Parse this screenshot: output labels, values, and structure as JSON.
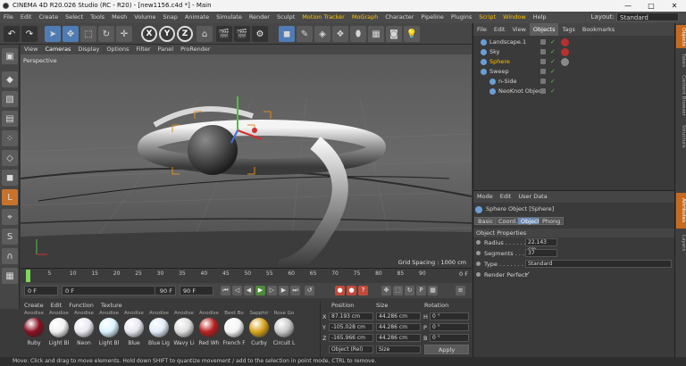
{
  "window": {
    "title": "CINEMA 4D R20.026 Studio (RC - R20) - [new1156.c4d *] - Main",
    "min": "—",
    "max": "□",
    "close": "✕"
  },
  "menubar": {
    "items": [
      "File",
      "Edit",
      "Create",
      "Select",
      "Tools",
      "Mesh",
      "Volume",
      "Snap",
      "Animate",
      "Simulate",
      "Render",
      "Sculpt",
      "Motion Tracker",
      "MoGraph",
      "Character",
      "Pipeline",
      "Plugins",
      "Script",
      "Window",
      "Help"
    ],
    "layout_label": "Layout:",
    "layout_value": "Standard"
  },
  "toolbar": {
    "x": "X",
    "y": "Y",
    "z": "Z"
  },
  "viewport": {
    "menu": [
      "View",
      "Cameras",
      "Display",
      "Options",
      "Filter",
      "Panel",
      "ProRender"
    ],
    "camera": "Perspective",
    "grid_spacing": "Grid Spacing : 1000 cm"
  },
  "timeline": {
    "ticks": [
      "0",
      "5",
      "10",
      "15",
      "20",
      "25",
      "30",
      "35",
      "40",
      "45",
      "50",
      "55",
      "60",
      "65",
      "70",
      "75",
      "80",
      "85",
      "90"
    ],
    "end": "0 F",
    "start_field": "0 F",
    "min_field": "0 F",
    "max_field": "90 F",
    "end_field": "90 F"
  },
  "materials": {
    "menu": [
      "Create",
      "Edit",
      "Function",
      "Texture"
    ],
    "items": [
      {
        "header": "Anodise",
        "name": "Ruby",
        "color": "#8a1020"
      },
      {
        "header": "Anodise",
        "name": "Light Bl",
        "color": "#f0f0f0"
      },
      {
        "header": "Anodise",
        "name": "Neon",
        "color": "#e8e8f0"
      },
      {
        "header": "Anodise",
        "name": "Light Bl",
        "color": "#d8f4ff"
      },
      {
        "header": "Anodise",
        "name": "Blue",
        "color": "#e6e6f0"
      },
      {
        "header": "Anodise",
        "name": "Blue Lig",
        "color": "#e0ecf8"
      },
      {
        "header": "Anodise",
        "name": "Wavy Li",
        "color": "#dddddd"
      },
      {
        "header": "Anodise",
        "name": "Red Wh",
        "color": "#b82020"
      },
      {
        "header": "Beet Bo",
        "name": "French F",
        "color": "#f4f4f4"
      },
      {
        "header": "Sapphir",
        "name": "Curby",
        "color": "#d8a21a"
      },
      {
        "header": "Rose Go",
        "name": "Circuit L",
        "color": "#c8c8c8"
      }
    ]
  },
  "coordinates": {
    "headers": {
      "position": "Position",
      "size": "Size",
      "rotation": "Rotation"
    },
    "rows": [
      {
        "axis": "X",
        "pos": "87.193 cm",
        "size": "44.286 cm",
        "rot_label": "H",
        "rot": "0 °"
      },
      {
        "axis": "Y",
        "pos": "-105.028 cm",
        "size": "44.286 cm",
        "rot_label": "P",
        "rot": "0 °"
      },
      {
        "axis": "Z",
        "pos": "-165.966 cm",
        "size": "44.286 cm",
        "rot_label": "B",
        "rot": "0 °"
      }
    ],
    "mode": "Object (Rel)",
    "size_mode": "Size",
    "apply": "Apply"
  },
  "objects": {
    "menu": [
      "File",
      "Edit",
      "View",
      "Objects",
      "Tags",
      "Bookmarks"
    ],
    "items": [
      {
        "name": "Landscape.1",
        "indent": 0,
        "selected": false
      },
      {
        "name": "Sky",
        "indent": 0,
        "selected": false
      },
      {
        "name": "Sphere",
        "indent": 0,
        "selected": true
      },
      {
        "name": "Sweep",
        "indent": 0,
        "selected": false
      },
      {
        "name": "n-Side",
        "indent": 1,
        "selected": false
      },
      {
        "name": "NeoKnot Object",
        "indent": 1,
        "selected": false
      }
    ]
  },
  "attributes": {
    "menu": [
      "Mode",
      "Edit",
      "User Data"
    ],
    "object_title": "Sphere Object [Sphere]",
    "tabs": [
      "Basic",
      "Coord.",
      "Object",
      "Phong"
    ],
    "section": "Object Properties",
    "radius_label": "Radius . . . . . . .",
    "radius": "22.143 cm",
    "segments_label": "Segments . . . . .",
    "segments": "37",
    "type_label": "Type . . . . . . . . .",
    "type": "Standard",
    "render_perfect_label": "Render Perfect",
    "render_perfect": "✓"
  },
  "right_tabs": [
    "Objects",
    "Takes",
    "Content Browser",
    "Structure",
    "Attributes",
    "Layers"
  ],
  "status": "Move: Click and drag to move elements. Hold down SHIFT to quantize movement / add to the selection in point mode, CTRL to remove.",
  "colors": {
    "accent_orange": "#c86a1e",
    "select_blue": "#4f7cb5",
    "highlight_yellow": "#ffc000"
  }
}
